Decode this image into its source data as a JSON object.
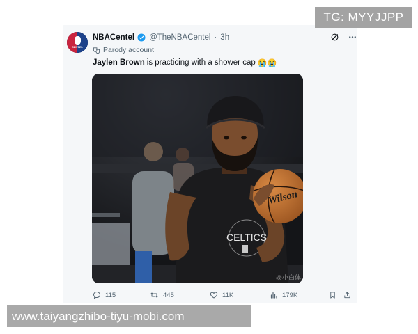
{
  "post": {
    "display_name": "NBACentel",
    "handle": "@TheNBACentel",
    "separator": "·",
    "time": "3h",
    "parody_label": "Parody account",
    "text_bold": "Jaylen Brown",
    "text_rest": "is practicing with a shower cap",
    "emoji": "😭😭",
    "avatar_text": "CENTEL",
    "verified_color": "#1d9bf0",
    "icons": [
      "grok-icon",
      "more-icon"
    ]
  },
  "photo": {
    "jersey_text": "CELTICS",
    "ball_text": "Wilson",
    "watermark": "@小白体"
  },
  "actions": {
    "replies": "115",
    "reposts": "445",
    "likes": "11K",
    "views": "179K"
  },
  "overlays": {
    "tg_badge": "TG: MYYJJPP",
    "url_banner": "www.taiyangzhibo-tiyu-mobi.com"
  }
}
